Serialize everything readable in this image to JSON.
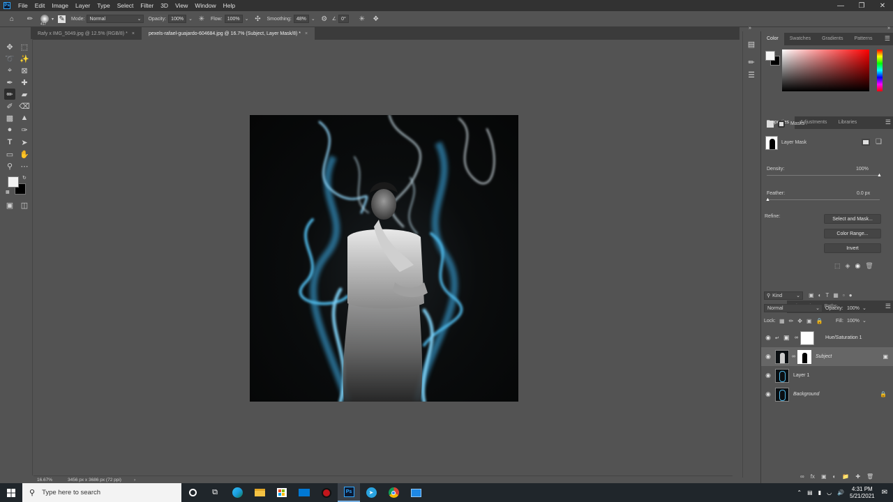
{
  "menu": [
    "File",
    "Edit",
    "Image",
    "Layer",
    "Type",
    "Select",
    "Filter",
    "3D",
    "View",
    "Window",
    "Help"
  ],
  "options": {
    "brush_size": "417",
    "mode_label": "Mode:",
    "mode_value": "Normal",
    "opacity_label": "Opacity:",
    "opacity_value": "100%",
    "flow_label": "Flow:",
    "flow_value": "100%",
    "smoothing_label": "Smoothing:",
    "smoothing_value": "48%",
    "angle_value": "0°"
  },
  "tabs": [
    {
      "label": "Rafy x IMG_5049.jpg @ 12.5% (RGB/8) *"
    },
    {
      "label": "pexels-rafael-guajardo-604684.jpg @ 16.7% (Subject, Layer Mask/8) *"
    }
  ],
  "status": {
    "zoom": "16.67%",
    "doc_info": "3456 px x 3686 px (72 ppi)"
  },
  "color_panel": {
    "tabs": [
      "Color",
      "Swatches",
      "Gradients",
      "Patterns"
    ]
  },
  "properties_panel": {
    "tabs": [
      "Properties",
      "Adjustments",
      "Libraries"
    ],
    "masks_label": "Masks",
    "layer_mask_label": "Layer Mask",
    "density_label": "Density:",
    "density_value": "100%",
    "feather_label": "Feather:",
    "feather_value": "0.0 px",
    "refine_label": "Refine:",
    "select_mask_button": "Select and Mask...",
    "color_range_button": "Color Range...",
    "invert_button": "Invert"
  },
  "layers_panel": {
    "tabs": [
      "Layers",
      "Channels",
      "Paths"
    ],
    "kind_label": "Kind",
    "blend_mode": "Normal",
    "opacity_label": "Opacity:",
    "opacity_value": "100%",
    "lock_label": "Lock:",
    "fill_label": "Fill:",
    "fill_value": "100%",
    "layers": [
      {
        "name": "Hue/Saturation 1"
      },
      {
        "name": "Subject"
      },
      {
        "name": "Layer 1"
      },
      {
        "name": "Background"
      }
    ]
  },
  "taskbar": {
    "search_placeholder": "Type here to search",
    "time": "4:31 PM",
    "date": "5/21/2021"
  },
  "colors": {
    "accent": "#31a8ff",
    "canvas_bg": "#535353",
    "smoke": "#4fb8e8"
  }
}
